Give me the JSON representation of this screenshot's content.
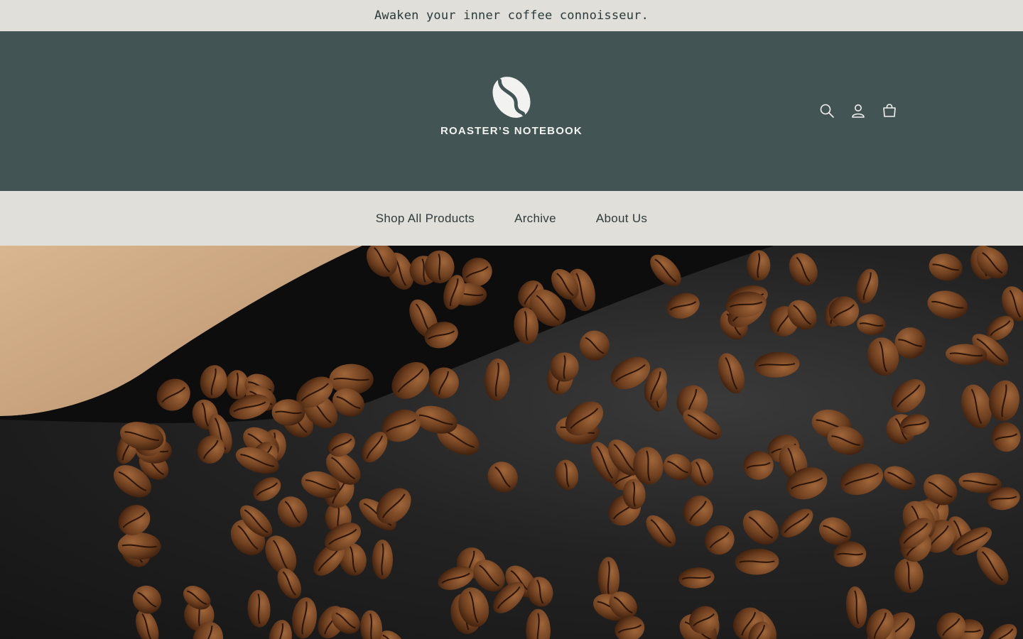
{
  "announcement": {
    "text": "Awaken your inner coffee connoisseur."
  },
  "header": {
    "logo_text": "ROASTER’S NOTEBOOK",
    "icons": [
      "search-icon",
      "account-icon",
      "cart-icon"
    ]
  },
  "nav": {
    "items": [
      {
        "label": "Shop All Products"
      },
      {
        "label": "Archive"
      },
      {
        "label": "About Us"
      }
    ]
  },
  "hero": {
    "image": "coffee beans spilling from kraft bag on dark stone surface"
  },
  "colors": {
    "announcement_bg": "#e0dfd9",
    "header_bg": "#425454",
    "nav_bg": "#e0dfd9",
    "text_dark": "#2f3b3b",
    "logo_light": "#f2f2f0"
  }
}
